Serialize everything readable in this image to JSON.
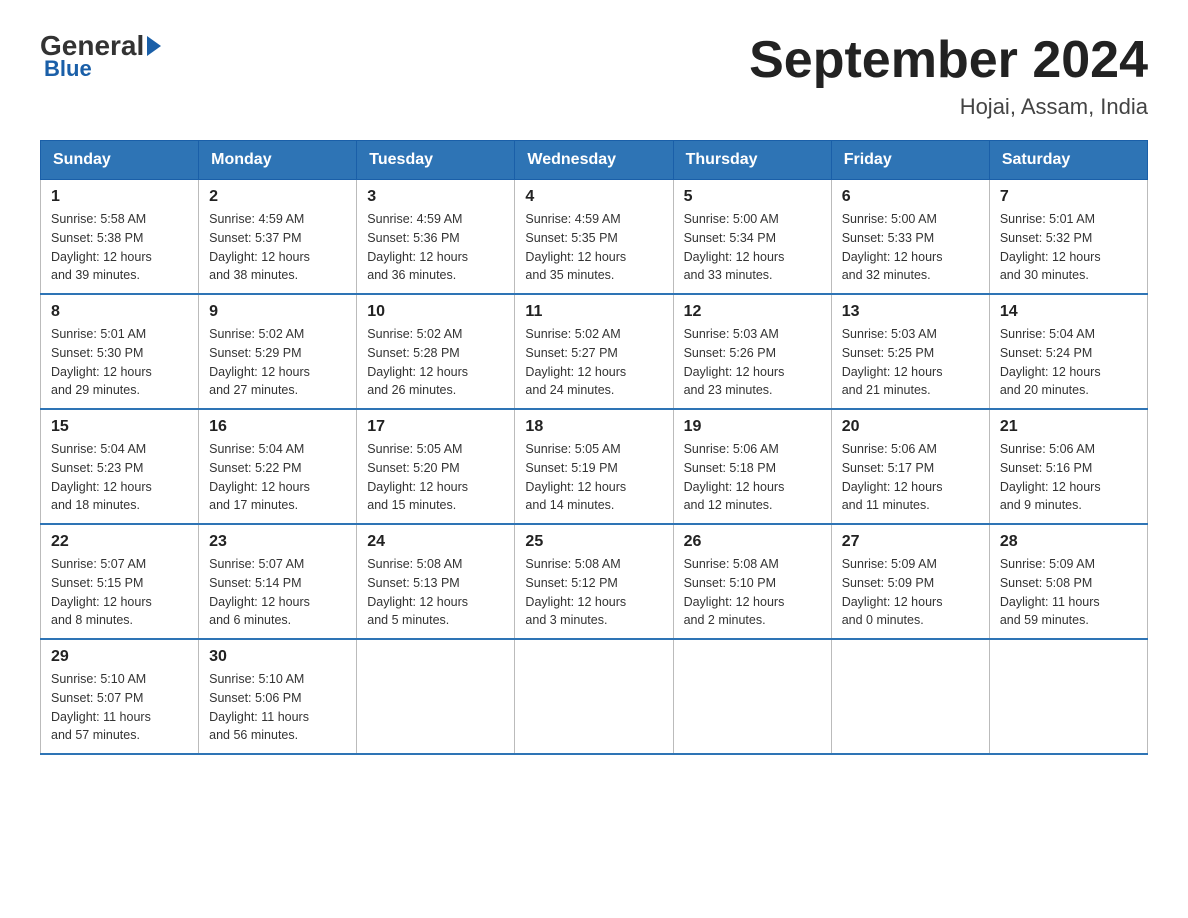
{
  "logo": {
    "general": "General",
    "blue": "Blue"
  },
  "title": "September 2024",
  "location": "Hojai, Assam, India",
  "days_of_week": [
    "Sunday",
    "Monday",
    "Tuesday",
    "Wednesday",
    "Thursday",
    "Friday",
    "Saturday"
  ],
  "weeks": [
    [
      {
        "day": "1",
        "sunrise": "5:58 AM",
        "sunset": "5:38 PM",
        "daylight": "12 hours and 39 minutes."
      },
      {
        "day": "2",
        "sunrise": "4:59 AM",
        "sunset": "5:37 PM",
        "daylight": "12 hours and 38 minutes."
      },
      {
        "day": "3",
        "sunrise": "4:59 AM",
        "sunset": "5:36 PM",
        "daylight": "12 hours and 36 minutes."
      },
      {
        "day": "4",
        "sunrise": "4:59 AM",
        "sunset": "5:35 PM",
        "daylight": "12 hours and 35 minutes."
      },
      {
        "day": "5",
        "sunrise": "5:00 AM",
        "sunset": "5:34 PM",
        "daylight": "12 hours and 33 minutes."
      },
      {
        "day": "6",
        "sunrise": "5:00 AM",
        "sunset": "5:33 PM",
        "daylight": "12 hours and 32 minutes."
      },
      {
        "day": "7",
        "sunrise": "5:01 AM",
        "sunset": "5:32 PM",
        "daylight": "12 hours and 30 minutes."
      }
    ],
    [
      {
        "day": "8",
        "sunrise": "5:01 AM",
        "sunset": "5:30 PM",
        "daylight": "12 hours and 29 minutes."
      },
      {
        "day": "9",
        "sunrise": "5:02 AM",
        "sunset": "5:29 PM",
        "daylight": "12 hours and 27 minutes."
      },
      {
        "day": "10",
        "sunrise": "5:02 AM",
        "sunset": "5:28 PM",
        "daylight": "12 hours and 26 minutes."
      },
      {
        "day": "11",
        "sunrise": "5:02 AM",
        "sunset": "5:27 PM",
        "daylight": "12 hours and 24 minutes."
      },
      {
        "day": "12",
        "sunrise": "5:03 AM",
        "sunset": "5:26 PM",
        "daylight": "12 hours and 23 minutes."
      },
      {
        "day": "13",
        "sunrise": "5:03 AM",
        "sunset": "5:25 PM",
        "daylight": "12 hours and 21 minutes."
      },
      {
        "day": "14",
        "sunrise": "5:04 AM",
        "sunset": "5:24 PM",
        "daylight": "12 hours and 20 minutes."
      }
    ],
    [
      {
        "day": "15",
        "sunrise": "5:04 AM",
        "sunset": "5:23 PM",
        "daylight": "12 hours and 18 minutes."
      },
      {
        "day": "16",
        "sunrise": "5:04 AM",
        "sunset": "5:22 PM",
        "daylight": "12 hours and 17 minutes."
      },
      {
        "day": "17",
        "sunrise": "5:05 AM",
        "sunset": "5:20 PM",
        "daylight": "12 hours and 15 minutes."
      },
      {
        "day": "18",
        "sunrise": "5:05 AM",
        "sunset": "5:19 PM",
        "daylight": "12 hours and 14 minutes."
      },
      {
        "day": "19",
        "sunrise": "5:06 AM",
        "sunset": "5:18 PM",
        "daylight": "12 hours and 12 minutes."
      },
      {
        "day": "20",
        "sunrise": "5:06 AM",
        "sunset": "5:17 PM",
        "daylight": "12 hours and 11 minutes."
      },
      {
        "day": "21",
        "sunrise": "5:06 AM",
        "sunset": "5:16 PM",
        "daylight": "12 hours and 9 minutes."
      }
    ],
    [
      {
        "day": "22",
        "sunrise": "5:07 AM",
        "sunset": "5:15 PM",
        "daylight": "12 hours and 8 minutes."
      },
      {
        "day": "23",
        "sunrise": "5:07 AM",
        "sunset": "5:14 PM",
        "daylight": "12 hours and 6 minutes."
      },
      {
        "day": "24",
        "sunrise": "5:08 AM",
        "sunset": "5:13 PM",
        "daylight": "12 hours and 5 minutes."
      },
      {
        "day": "25",
        "sunrise": "5:08 AM",
        "sunset": "5:12 PM",
        "daylight": "12 hours and 3 minutes."
      },
      {
        "day": "26",
        "sunrise": "5:08 AM",
        "sunset": "5:10 PM",
        "daylight": "12 hours and 2 minutes."
      },
      {
        "day": "27",
        "sunrise": "5:09 AM",
        "sunset": "5:09 PM",
        "daylight": "12 hours and 0 minutes."
      },
      {
        "day": "28",
        "sunrise": "5:09 AM",
        "sunset": "5:08 PM",
        "daylight": "11 hours and 59 minutes."
      }
    ],
    [
      {
        "day": "29",
        "sunrise": "5:10 AM",
        "sunset": "5:07 PM",
        "daylight": "11 hours and 57 minutes."
      },
      {
        "day": "30",
        "sunrise": "5:10 AM",
        "sunset": "5:06 PM",
        "daylight": "11 hours and 56 minutes."
      },
      null,
      null,
      null,
      null,
      null
    ]
  ],
  "labels": {
    "sunrise": "Sunrise:",
    "sunset": "Sunset:",
    "daylight": "Daylight:"
  },
  "colors": {
    "header_bg": "#2e74b5",
    "header_text": "#ffffff",
    "border": "#999999"
  }
}
